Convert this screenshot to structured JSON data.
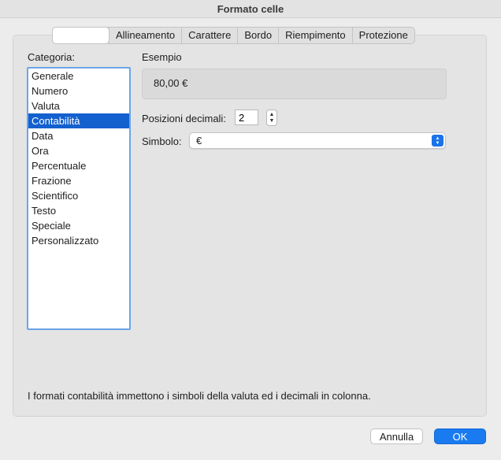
{
  "window": {
    "title": "Formato celle"
  },
  "tabs": [
    {
      "label": ""
    },
    {
      "label": "Allineamento"
    },
    {
      "label": "Carattere"
    },
    {
      "label": "Bordo"
    },
    {
      "label": "Riempimento"
    },
    {
      "label": "Protezione"
    }
  ],
  "category": {
    "label": "Categoria:",
    "items": [
      "Generale",
      "Numero",
      "Valuta",
      "Contabilità",
      "Data",
      "Ora",
      "Percentuale",
      "Frazione",
      "Scientifico",
      "Testo",
      "Speciale",
      "Personalizzato"
    ],
    "selected": "Contabilità"
  },
  "sample": {
    "label": "Esempio",
    "value": "80,00 €"
  },
  "decimals": {
    "label": "Posizioni decimali:",
    "value": "2"
  },
  "symbol": {
    "label": "Simbolo:",
    "value": "€"
  },
  "description": "I formati contabilità immettono i simboli della valuta ed i decimali in colonna.",
  "buttons": {
    "cancel": "Annulla",
    "ok": "OK"
  },
  "colors": {
    "accent": "#1a7bf0",
    "selection": "#1360cf",
    "list_border": "#6aa5e8"
  }
}
